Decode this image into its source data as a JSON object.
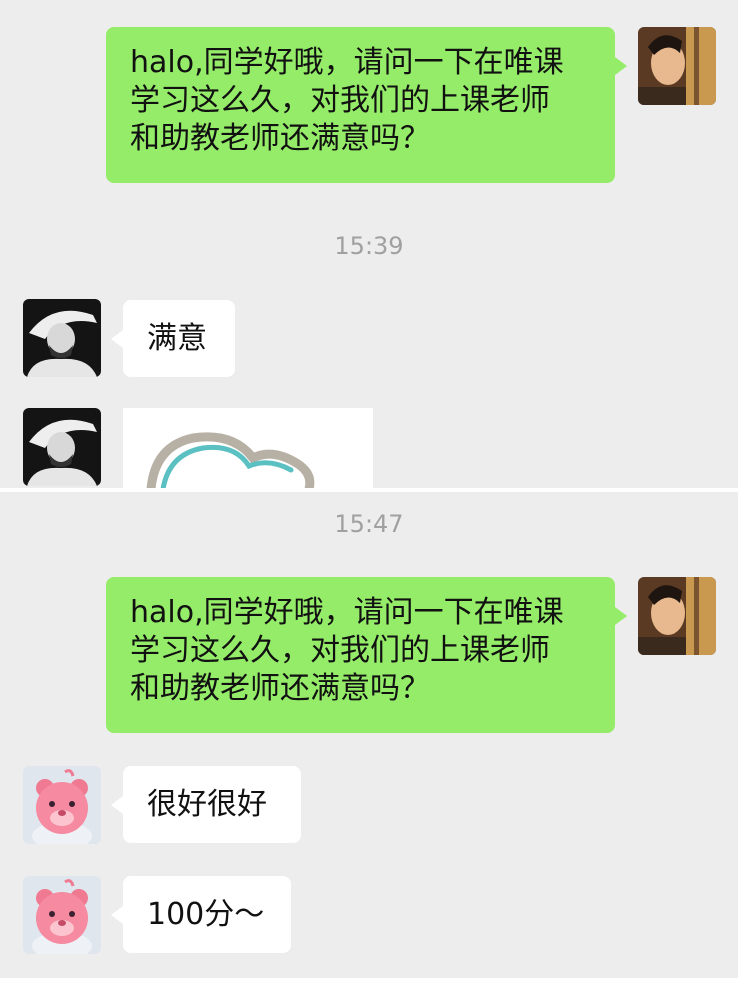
{
  "panel1": {
    "outgoing_message": {
      "lines": [
        "halo,同学好哦，请问一下在唯课",
        "学习这么久，对我们的上课老师",
        "和助教老师还满意吗？"
      ]
    },
    "timestamp": "15:39",
    "incoming_text": "满意",
    "incoming_image": "sticker-image"
  },
  "panel2": {
    "timestamp": "15:47",
    "outgoing_message": {
      "lines": [
        "halo,同学好哦，请问一下在唯课",
        "学习这么久，对我们的上课老师",
        "和助教老师还满意吗？"
      ]
    },
    "incoming_messages": [
      "很好很好",
      "100分～"
    ]
  },
  "colors": {
    "outgoing_bubble": "#95ec69",
    "incoming_bubble": "#ffffff",
    "background": "#ededed",
    "timestamp": "#a0a0a0"
  },
  "icons": {
    "sender_avatar": "sender-avatar",
    "student1_avatar": "student-sketch-avatar",
    "student2_avatar": "pink-bear-avatar"
  }
}
